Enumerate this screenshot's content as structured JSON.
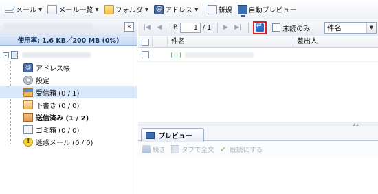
{
  "toolbar": {
    "mail_label": "メール",
    "mail_list_label": "メール一覧",
    "folder_label": "フォルダ",
    "address_label": "アドレス",
    "new_label": "新規",
    "auto_preview_label": "自動プレビュー"
  },
  "sidebar": {
    "collapse_glyph": "«",
    "usage_text": "使用率: 1.6 KB／200 MB (0%)",
    "tree_expand_glyph": "-",
    "items": [
      {
        "label": "アドレス帳",
        "icon": "address-book-icon"
      },
      {
        "label": "設定",
        "icon": "gear-icon"
      },
      {
        "label": "受信箱 (0 / 1)",
        "icon": "inbox-icon",
        "selected": true
      },
      {
        "label": "下書き (0 / 0)",
        "icon": "drafts-icon"
      },
      {
        "label": "送信済み (1 / 2)",
        "icon": "sent-icon",
        "bold": true
      },
      {
        "label": "ゴミ箱 (0 / 0)",
        "icon": "trash-icon"
      },
      {
        "label": "迷惑メール (0 / 0)",
        "icon": "spam-icon"
      }
    ]
  },
  "pager": {
    "page_prefix": "P.",
    "page_value": "1",
    "page_total": "/ 1",
    "unread_only_label": "未読のみ",
    "sort_value": "件名"
  },
  "grid": {
    "col_subject": "件名",
    "col_from": "差出人"
  },
  "preview": {
    "tab_label": "プレビュー",
    "continue_label": "続き",
    "open_in_tab_label": "タブで全文",
    "mark_read_label": "既読にする"
  },
  "colors": {
    "accent": "#2f5ea8",
    "selection": "#d9e8fb",
    "highlight_border": "#d8242b"
  }
}
